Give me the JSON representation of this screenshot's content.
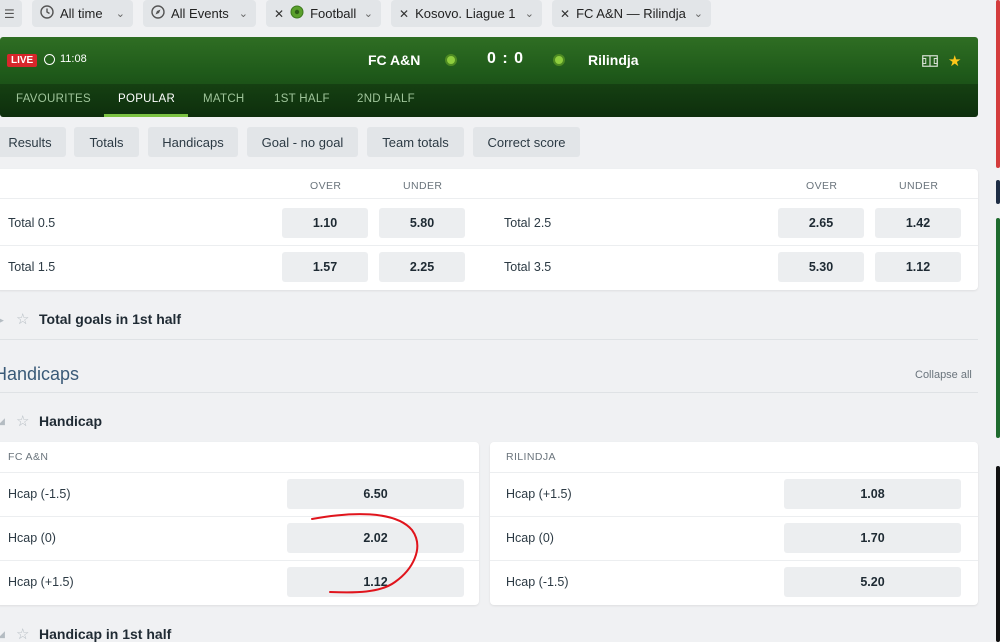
{
  "filters": [
    {
      "label": "All time",
      "icon": "clock-icon"
    },
    {
      "label": "All Events",
      "icon": "compass-icon"
    },
    {
      "label": "Football",
      "icon": "football-icon"
    },
    {
      "label": "Kosovo. Liague 1"
    },
    {
      "label": "FC A&N — Rilindja"
    }
  ],
  "match": {
    "live_badge": "LIVE",
    "time": "11:08",
    "home": "FC A&N",
    "away": "Rilindja",
    "score": "0 : 0"
  },
  "tabs": [
    "FAVOURITES",
    "POPULAR",
    "MATCH",
    "1ST HALF",
    "2ND HALF"
  ],
  "active_tab": "POPULAR",
  "market_buttons": [
    "Results",
    "Totals",
    "Handicaps",
    "Goal - no goal",
    "Team totals",
    "Correct score"
  ],
  "totals": {
    "col_over": "OVER",
    "col_under": "UNDER",
    "rows": [
      {
        "label": "Total 0.5",
        "over": "1.10",
        "under": "5.80"
      },
      {
        "label": "Total 1.5",
        "over": "1.57",
        "under": "2.25"
      },
      {
        "label": "Total 2.5",
        "over": "2.65",
        "under": "1.42"
      },
      {
        "label": "Total 3.5",
        "over": "5.30",
        "under": "1.12"
      }
    ]
  },
  "total_goals_1st_half": "Total goals in 1st half",
  "handicaps_section": {
    "title": "Handicaps",
    "collapse_all": "Collapse all",
    "handicap_title": "Handicap",
    "home_header": "FC A&N",
    "away_header": "RILINDJA",
    "home_rows": [
      {
        "label": "Hcap (-1.5)",
        "odd": "6.50"
      },
      {
        "label": "Hcap (0)",
        "odd": "2.02"
      },
      {
        "label": "Hcap (+1.5)",
        "odd": "1.12"
      }
    ],
    "away_rows": [
      {
        "label": "Hcap (+1.5)",
        "odd": "1.08"
      },
      {
        "label": "Hcap (0)",
        "odd": "1.70"
      },
      {
        "label": "Hcap (-1.5)",
        "odd": "5.20"
      }
    ],
    "handicap_1st_half": "Handicap in 1st half"
  },
  "colors": {
    "header_green": "#1f5a1a",
    "accent_green": "#7bc242",
    "live_red": "#d8262b",
    "star_yellow": "#ffc61a",
    "annotation_red": "#e0141c"
  }
}
